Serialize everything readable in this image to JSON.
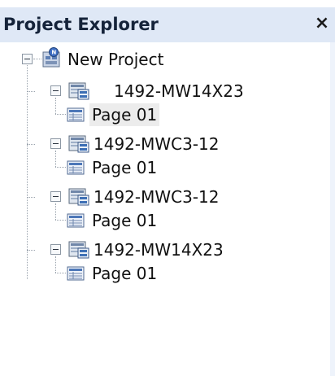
{
  "panel": {
    "title": "Project Explorer",
    "close_label": "×"
  },
  "tree": {
    "root": {
      "label": "New Project",
      "icon": "project-icon"
    },
    "devices": [
      {
        "label": "1492-MW14X23",
        "icon": "device-icon",
        "page": {
          "label": "Page 01",
          "icon": "page-icon",
          "selected": true
        }
      },
      {
        "label": "1492-MWC3-12",
        "icon": "device-icon",
        "page": {
          "label": "Page 01",
          "icon": "page-icon",
          "selected": false
        }
      },
      {
        "label": "1492-MWC3-12",
        "icon": "device-icon",
        "page": {
          "label": "Page 01",
          "icon": "page-icon",
          "selected": false
        }
      },
      {
        "label": "1492-MW14X23",
        "icon": "device-icon",
        "page": {
          "label": "Page 01",
          "icon": "page-icon",
          "selected": false
        }
      }
    ]
  },
  "colors": {
    "header_bg": "#dfe8f6",
    "selection_bg": "#ececec",
    "text": "#111111"
  }
}
